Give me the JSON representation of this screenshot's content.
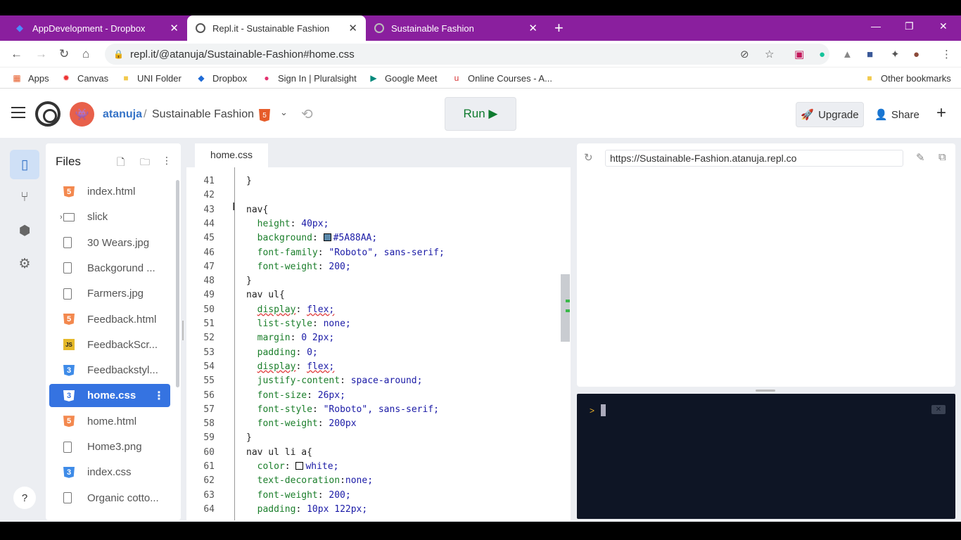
{
  "browser": {
    "tabs": [
      {
        "title": "AppDevelopment - Dropbox",
        "icon": "dropbox-icon"
      },
      {
        "title": "Repl.it - Sustainable Fashion",
        "icon": "replit-icon"
      },
      {
        "title": "Sustainable Fashion",
        "icon": "globe-icon"
      }
    ],
    "close": "✕",
    "new_tab": "+",
    "url": "repl.it/@atanuja/Sustainable-Fashion#home.css",
    "bookmarks": [
      "Apps",
      "Canvas",
      "UNI Folder",
      "Dropbox",
      "Sign In | Pluralsight",
      "Google Meet",
      "Online Courses - A...",
      "Other bookmarks"
    ]
  },
  "header": {
    "username": "atanuja",
    "separator": "/",
    "project": "Sustainable Fashion",
    "run_label": "Run ▶",
    "upgrade_label": "Upgrade",
    "share_label": "Share"
  },
  "files": {
    "title": "Files",
    "items": [
      {
        "name": "index.html",
        "type": "html"
      },
      {
        "name": "slick",
        "type": "folder"
      },
      {
        "name": "30 Wears.jpg",
        "type": "file"
      },
      {
        "name": "Backgorund ...",
        "type": "file"
      },
      {
        "name": "Farmers.jpg",
        "type": "file"
      },
      {
        "name": "Feedback.html",
        "type": "html"
      },
      {
        "name": "FeedbackScr...",
        "type": "js"
      },
      {
        "name": "Feedbackstyl...",
        "type": "css"
      },
      {
        "name": "home.css",
        "type": "css",
        "selected": true
      },
      {
        "name": "home.html",
        "type": "html"
      },
      {
        "name": "Home3.png",
        "type": "file"
      },
      {
        "name": "index.css",
        "type": "css"
      },
      {
        "name": "Organic cotto...",
        "type": "file"
      }
    ]
  },
  "editor": {
    "tab": "home.css",
    "lines": [
      {
        "n": "41",
        "t": "}"
      },
      {
        "n": "42",
        "t": ""
      },
      {
        "n": "43",
        "t": "nav{"
      },
      {
        "n": "44",
        "t": "  height: 40px;"
      },
      {
        "n": "45",
        "t": "  background: #5A88AA;"
      },
      {
        "n": "46",
        "t": "  font-family: \"Roboto\", sans-serif;"
      },
      {
        "n": "47",
        "t": "  font-weight: 200;"
      },
      {
        "n": "48",
        "t": "}"
      },
      {
        "n": "49",
        "t": "nav ul{"
      },
      {
        "n": "50",
        "t": "  display: flex;"
      },
      {
        "n": "51",
        "t": "  list-style: none;"
      },
      {
        "n": "52",
        "t": "  margin: 0 2px;"
      },
      {
        "n": "53",
        "t": "  padding: 0;"
      },
      {
        "n": "54",
        "t": "  display: flex;"
      },
      {
        "n": "55",
        "t": "  justify-content: space-around;"
      },
      {
        "n": "56",
        "t": "  font-size: 26px;"
      },
      {
        "n": "57",
        "t": "  font-style: \"Roboto\", sans-serif;"
      },
      {
        "n": "58",
        "t": "  font-weight: 200px"
      },
      {
        "n": "59",
        "t": "}"
      },
      {
        "n": "60",
        "t": "nav ul li a{"
      },
      {
        "n": "61",
        "t": "  color: white;"
      },
      {
        "n": "62",
        "t": "  text-decoration:none;"
      },
      {
        "n": "63",
        "t": "  font-weight: 200;"
      },
      {
        "n": "64",
        "t": "  padding: 10px 122px;"
      }
    ]
  },
  "preview": {
    "url": "https://Sustainable-Fashion.atanuja.repl.co"
  },
  "console": {
    "prompt": ">"
  },
  "colors": {
    "tabstrip": "#8a1f9e",
    "accent": "#3573e1",
    "run": "#0f7b2f",
    "swatch": "#5A88AA"
  }
}
